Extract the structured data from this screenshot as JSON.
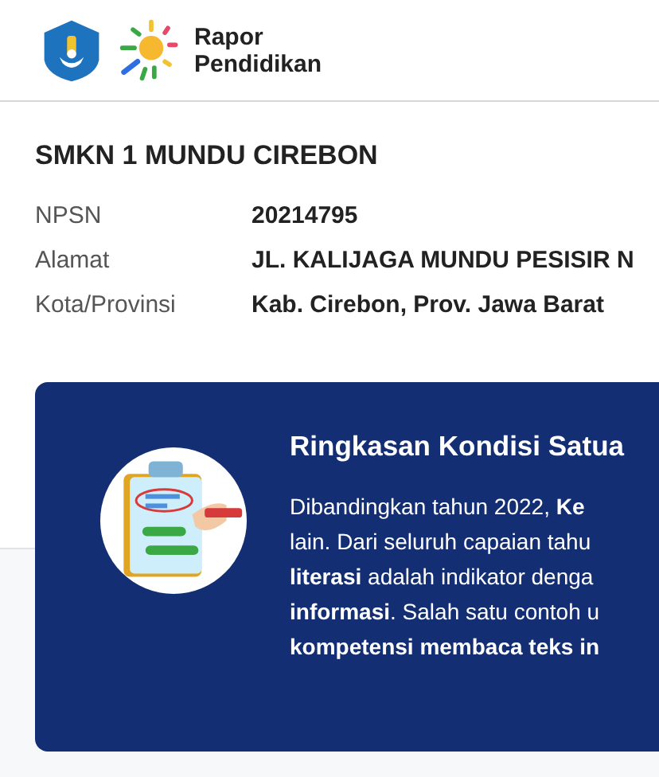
{
  "header": {
    "brand_line_1": "Rapor",
    "brand_line_2": "Pendidikan"
  },
  "school": {
    "name": "SMKN 1 MUNDU CIREBON",
    "fields": [
      {
        "label": "NPSN",
        "value": "20214795"
      },
      {
        "label": "Alamat",
        "value": "JL. KALIJAGA MUNDU PESISIR N"
      },
      {
        "label": "Kota/Provinsi",
        "value": "Kab. Cirebon, Prov. Jawa Barat"
      }
    ]
  },
  "summary": {
    "title": "Ringkasan Kondisi Satua",
    "lines": [
      "Dibandingkan tahun 2022, **Ke**",
      "lain. Dari seluruh capaian tahu",
      "**literasi** adalah indikator denga",
      "**informasi**. Salah satu contoh u",
      "**kompetensi membaca teks in**"
    ]
  }
}
